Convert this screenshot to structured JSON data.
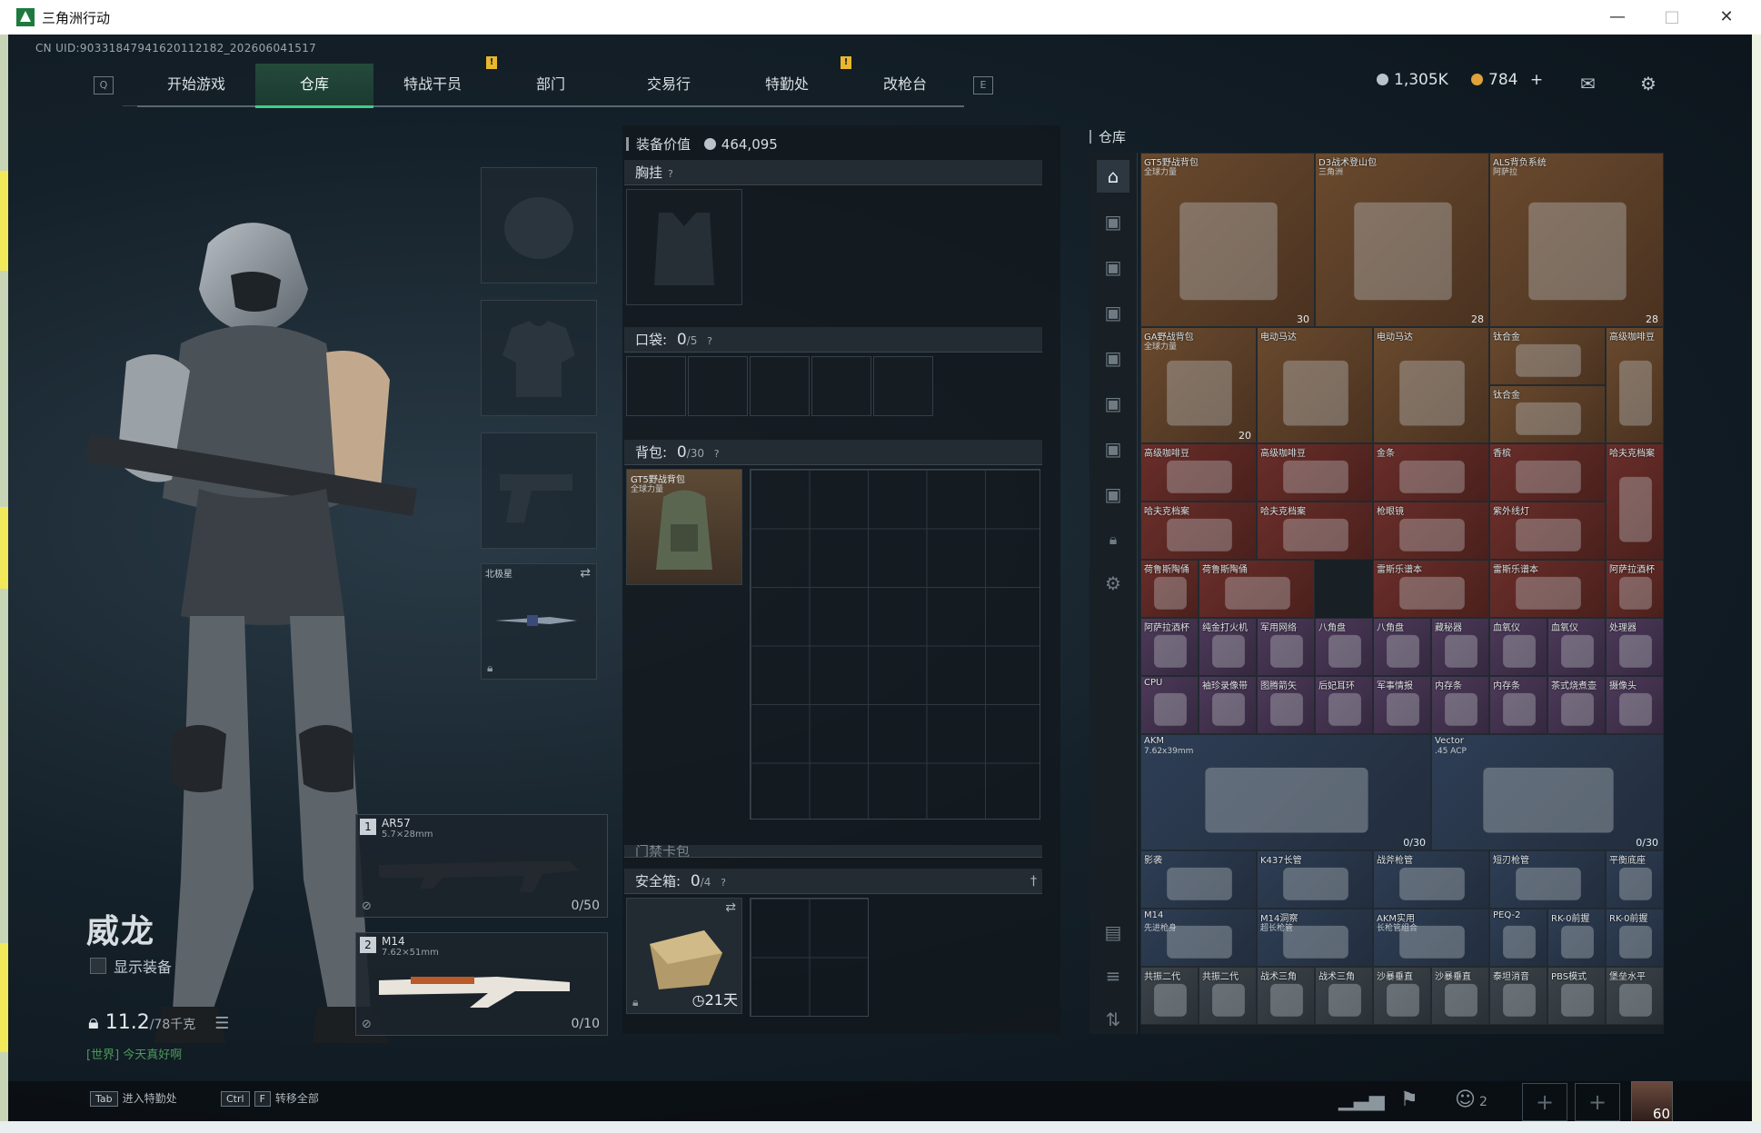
{
  "window": {
    "title": "三角洲行动"
  },
  "uid": "CN UID:90331847941620112182_202606041517",
  "nav": {
    "key_left": "Q",
    "key_right": "E",
    "tabs": [
      {
        "label": "开始游戏",
        "active": false
      },
      {
        "label": "仓库",
        "active": true
      },
      {
        "label": "特战干员",
        "active": false,
        "alert": true
      },
      {
        "label": "部门",
        "active": false
      },
      {
        "label": "交易行",
        "active": false
      },
      {
        "label": "特勤处",
        "active": false,
        "alert": true
      },
      {
        "label": "改枪台",
        "active": false
      }
    ],
    "alert_glyph": "!"
  },
  "currency": {
    "silver": "1,305K",
    "gold": "784",
    "add": "+",
    "silver_color": "#b9c3c9",
    "gold_color": "#e0a33a"
  },
  "operator": {
    "name": "威龙",
    "show_equipment": "显示装备",
    "weight": "11.2",
    "weight_max": "/78千克",
    "chat": "[世界] 今天真好啊"
  },
  "gear": {
    "melee": {
      "name": "北极星"
    },
    "primary": {
      "num": "1",
      "name": "AR57",
      "caliber": "5.7×28mm",
      "ammo": "0/50"
    },
    "secondary": {
      "num": "2",
      "name": "M14",
      "caliber": "7.62×51mm",
      "ammo": "0/10"
    }
  },
  "equipment": {
    "value_label": "装备价值",
    "value": "464,095",
    "chest": {
      "label": "胸挂",
      "q": "?"
    },
    "pocket": {
      "label": "口袋:",
      "count": "0",
      "max": "/5",
      "q": "?"
    },
    "backpack": {
      "label": "背包:",
      "count": "0",
      "max": "/30",
      "q": "?",
      "item_name": "GT5野战背包",
      "item_sub": "全球力量"
    },
    "keycard": {
      "label": "门禁卡包"
    },
    "safebox": {
      "label": "安全箱:",
      "count": "0",
      "max": "/4",
      "q": "?",
      "timer": "21天"
    }
  },
  "warehouse": {
    "title": "仓库",
    "items": [
      {
        "name": "GT5野战背包",
        "sub": "全球力量",
        "count": "30",
        "color": "gold"
      },
      {
        "name": "D3战术登山包",
        "sub": "三角洲",
        "count": "28",
        "color": "gold"
      },
      {
        "name": "ALS背负系统",
        "sub": "阿萨拉",
        "count": "28",
        "color": "gold"
      },
      {
        "name": "GA野战背包",
        "sub": "全球力量",
        "count": "20",
        "color": "gold"
      },
      {
        "name": "电动马达",
        "color": "gold"
      },
      {
        "name": "电动马达",
        "color": "gold"
      },
      {
        "name": "钛合金",
        "color": "gold"
      },
      {
        "name": "钛合金",
        "color": "gold"
      },
      {
        "name": "高级咖啡豆",
        "color": "gold"
      },
      {
        "name": "高级咖啡豆",
        "color": "red"
      },
      {
        "name": "高级咖啡豆",
        "color": "red"
      },
      {
        "name": "金条",
        "color": "red"
      },
      {
        "name": "香槟",
        "color": "red"
      },
      {
        "name": "哈夫克档案",
        "color": "red"
      },
      {
        "name": "哈夫克档案",
        "color": "red"
      },
      {
        "name": "哈夫克档案",
        "color": "red"
      },
      {
        "name": "枪眼镜",
        "color": "red"
      },
      {
        "name": "紫外线灯",
        "color": "red"
      },
      {
        "name": "荷鲁斯陶俑",
        "color": "red"
      },
      {
        "name": "荷鲁斯陶俑",
        "color": "red"
      },
      {
        "name": "雷斯乐谱本",
        "color": "red"
      },
      {
        "name": "雷斯乐谱本",
        "color": "red"
      },
      {
        "name": "阿萨拉酒杯",
        "color": "red"
      },
      {
        "name": "阿萨拉酒杯",
        "color": "purple"
      },
      {
        "name": "纯金打火机",
        "color": "purple"
      },
      {
        "name": "军用网络",
        "color": "purple"
      },
      {
        "name": "八角盘",
        "color": "purple"
      },
      {
        "name": "八角盘",
        "color": "purple"
      },
      {
        "name": "藏秘器",
        "color": "purple"
      },
      {
        "name": "血氧仪",
        "color": "purple"
      },
      {
        "name": "血氧仪",
        "color": "purple"
      },
      {
        "name": "处理器",
        "color": "purple"
      },
      {
        "name": "CPU",
        "color": "purple"
      },
      {
        "name": "袖珍录像带",
        "color": "purple"
      },
      {
        "name": "图腾箭矢",
        "color": "purple"
      },
      {
        "name": "后妃耳环",
        "color": "purple"
      },
      {
        "name": "军事情报",
        "color": "purple"
      },
      {
        "name": "内存条",
        "color": "purple"
      },
      {
        "name": "内存条",
        "color": "purple"
      },
      {
        "name": "茶式烧煮壶",
        "color": "purple"
      },
      {
        "name": "摄像头",
        "color": "purple"
      },
      {
        "name": "AKM",
        "sub": "7.62x39mm",
        "count": "0/30",
        "color": "blue"
      },
      {
        "name": "Vector",
        "sub": ".45 ACP",
        "count": "0/30",
        "color": "blue"
      },
      {
        "name": "影袭",
        "color": "blue"
      },
      {
        "name": "K437长管",
        "color": "blue"
      },
      {
        "name": "战斧枪管",
        "color": "blue"
      },
      {
        "name": "短刃枪管",
        "color": "blue"
      },
      {
        "name": "平衡底座",
        "color": "blue"
      },
      {
        "name": "M14",
        "sub": "先进枪身",
        "color": "blue"
      },
      {
        "name": "M14洞察",
        "sub": "超长枪管",
        "color": "blue"
      },
      {
        "name": "AKM实用",
        "sub": "长枪管组合",
        "color": "blue"
      },
      {
        "name": "PEQ-2",
        "color": "blue"
      },
      {
        "name": "RK-0前握",
        "color": "blue"
      },
      {
        "name": "RK-0前握",
        "color": "blue"
      },
      {
        "name": "共振二代",
        "color": "gray"
      },
      {
        "name": "共振二代",
        "color": "gray"
      },
      {
        "name": "战术三角",
        "color": "gray"
      },
      {
        "name": "战术三角",
        "color": "gray"
      },
      {
        "name": "沙暴垂直",
        "color": "gray"
      },
      {
        "name": "沙暴垂直",
        "color": "gray"
      },
      {
        "name": "泰坦消音",
        "color": "gray"
      },
      {
        "name": "PBS模式",
        "color": "gray"
      },
      {
        "name": "堡垒水平",
        "color": "gray"
      }
    ]
  },
  "footer": {
    "hint1_key": "Tab",
    "hint1_label": "进入特勤处",
    "hint2_key1": "Ctrl",
    "hint2_key2": "F",
    "hint2_label": "转移全部",
    "team_count": "2",
    "level": "60",
    "plus": "+"
  }
}
